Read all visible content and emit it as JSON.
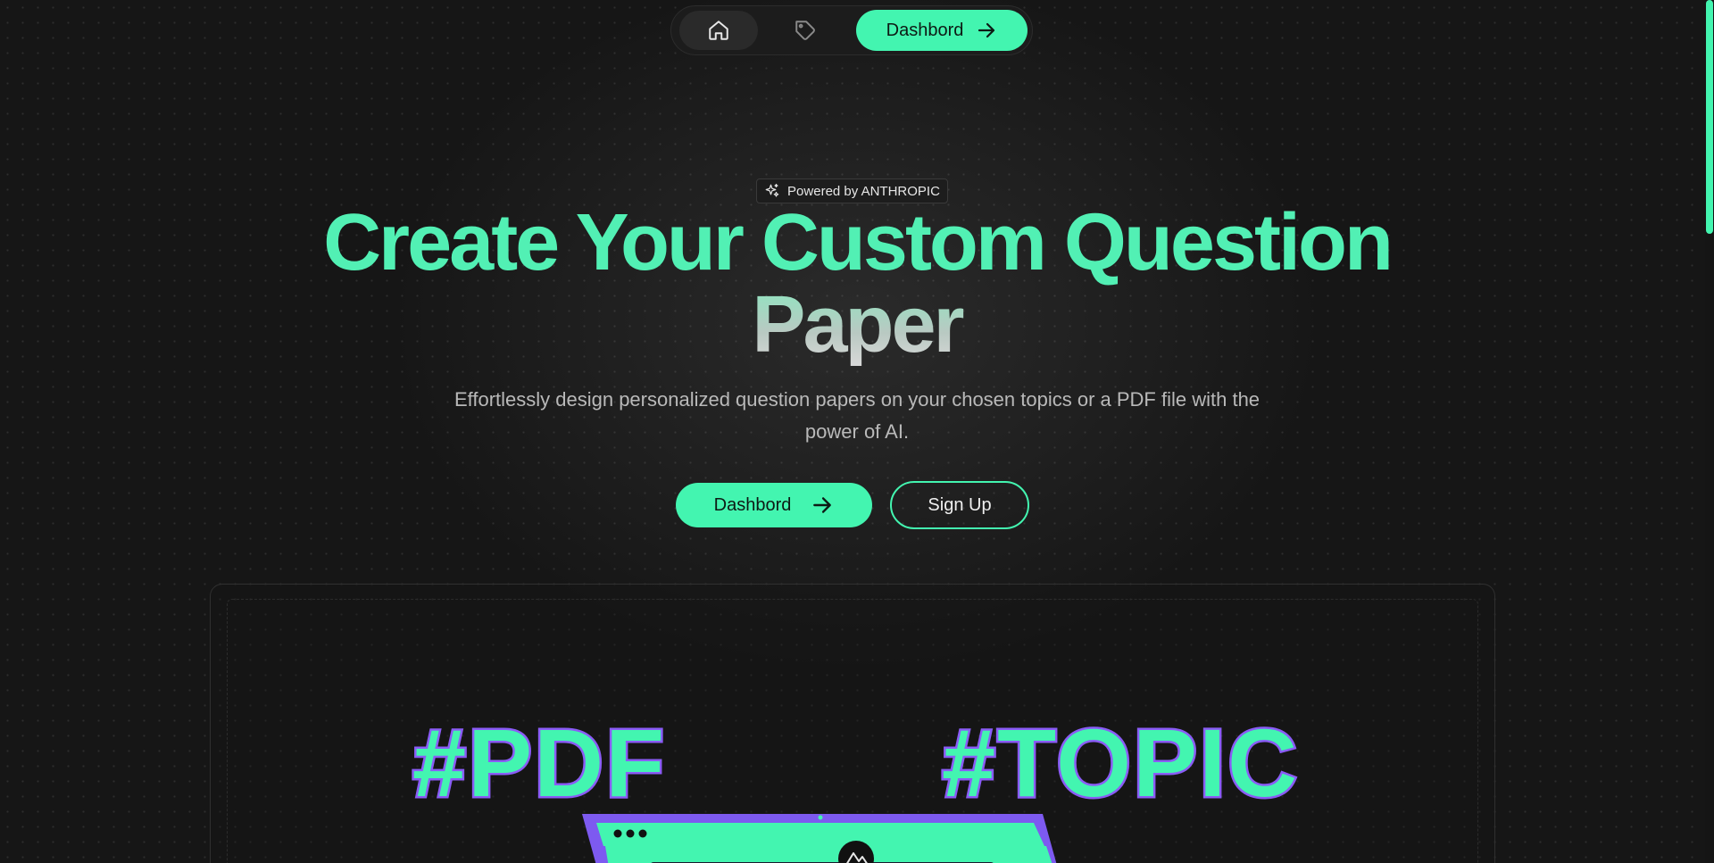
{
  "nav": {
    "home_icon": "home-icon",
    "tag_icon": "tag-icon",
    "dashboard_label": "Dashbord",
    "arrow_icon": "arrow-right-icon"
  },
  "hero": {
    "badge_icon": "sparkles-icon",
    "badge_text": "Powered by ANTHROPIC",
    "title_line1": "Create Your Custom Question",
    "title_line2": "Paper",
    "subtitle": "Effortlessly design personalized question papers on your chosen topics or a PDF file with the power of AI.",
    "primary_cta": "Dashbord",
    "secondary_cta": "Sign Up"
  },
  "preview": {
    "tag_pdf": "#PDF",
    "tag_topic": "#TOPIC",
    "logo_icon": "mountain-logo-icon"
  },
  "colors": {
    "accent": "#43f5b0",
    "outline": "#8a5cf6",
    "background": "#161616"
  }
}
